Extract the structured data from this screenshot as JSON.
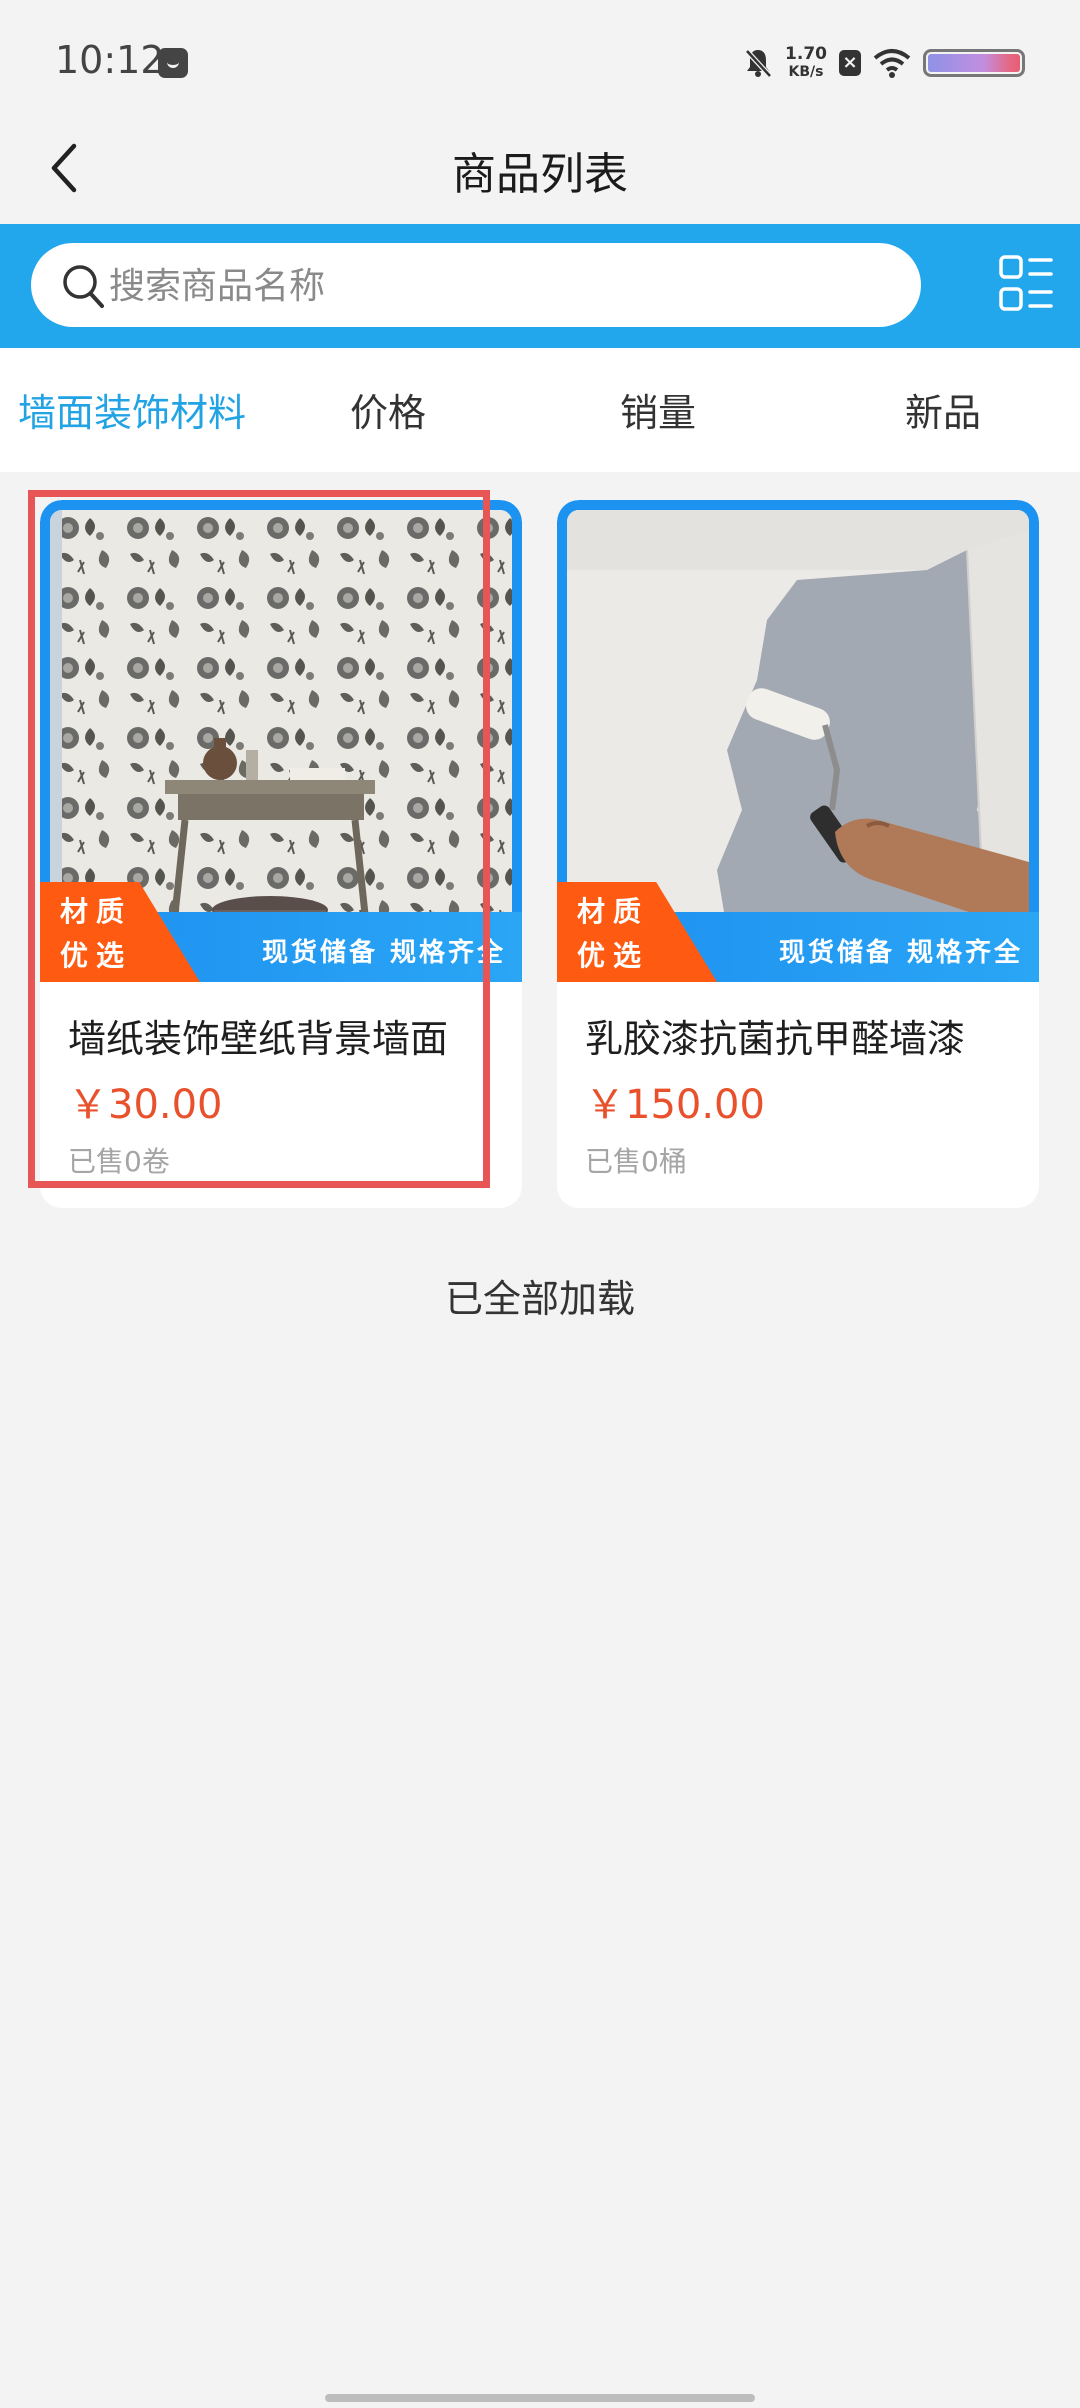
{
  "status_bar": {
    "time": "10:12",
    "net_speed_value": "1.70",
    "net_speed_unit": "KB/s"
  },
  "nav": {
    "title": "商品列表"
  },
  "search": {
    "placeholder": "搜索商品名称"
  },
  "tabs": [
    {
      "label": "墙面装饰材料",
      "active": true
    },
    {
      "label": "价格",
      "active": false
    },
    {
      "label": "销量",
      "active": false
    },
    {
      "label": "新品",
      "active": false
    }
  ],
  "products": [
    {
      "name": "墙纸装饰壁纸背景墙面",
      "price": "￥30.00",
      "sold": "已售0卷",
      "badge_line1": "材质",
      "badge_line2": "优选",
      "ribbon": "现货储备 规格齐全",
      "image": "floral-wallpaper-room-photo"
    },
    {
      "name": "乳胶漆抗菌抗甲醛墙漆",
      "price": "￥150.00",
      "sold": "已售0桶",
      "badge_line1": "材质",
      "badge_line2": "优选",
      "ribbon": "现货储备 规格齐全",
      "image": "paint-roller-wall-photo"
    }
  ],
  "list_footer": "已全部加载",
  "colors": {
    "accent": "#22a6ec",
    "price": "#e9502c",
    "badge": "#ff5a12",
    "highlight": "#e85555"
  }
}
